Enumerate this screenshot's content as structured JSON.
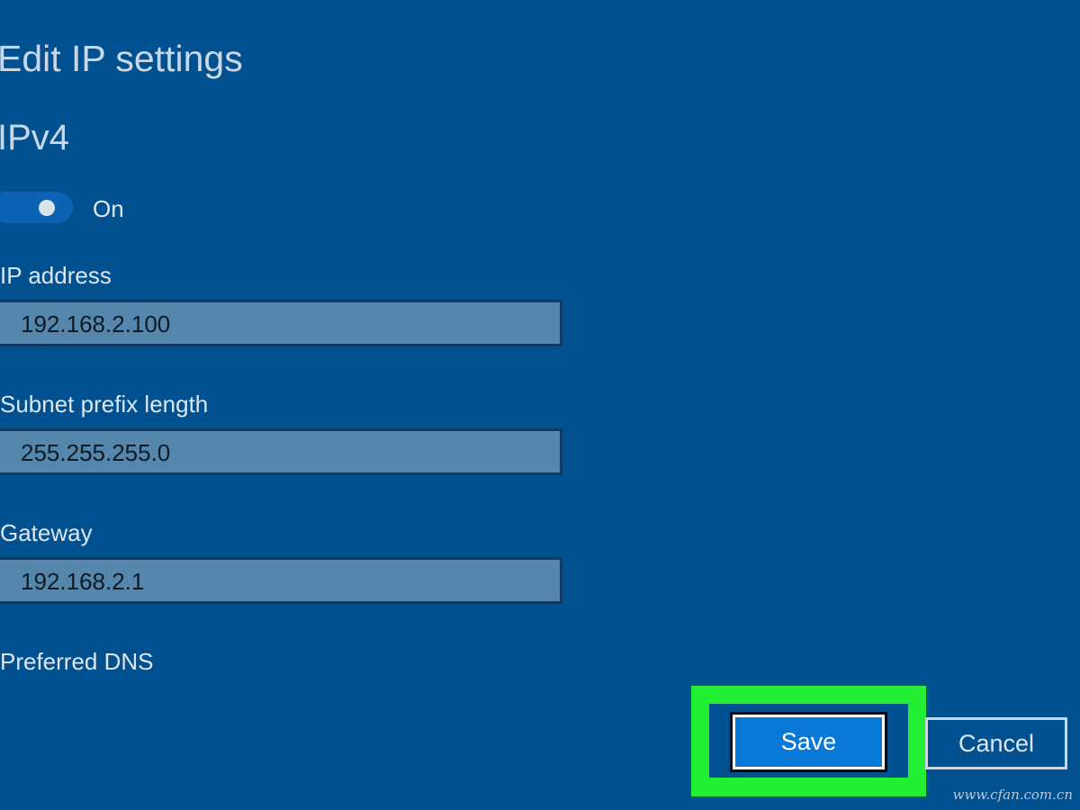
{
  "page": {
    "title": "Edit IP settings",
    "section": "IPv4",
    "background_color": "#015190",
    "accent_color": "#0a78d7",
    "highlight_color": "#22ee33"
  },
  "toggle": {
    "state_label": "On",
    "checked": true
  },
  "fields": {
    "ip_address": {
      "label": "IP address",
      "value": "192.168.2.100"
    },
    "subnet": {
      "label": "Subnet prefix length",
      "value": "255.255.255.0"
    },
    "gateway": {
      "label": "Gateway",
      "value": "192.168.2.1"
    },
    "dns": {
      "label": "Preferred DNS"
    }
  },
  "buttons": {
    "save_label": "Save",
    "cancel_label": "Cancel"
  },
  "watermark": "www.cfan.com.cn"
}
